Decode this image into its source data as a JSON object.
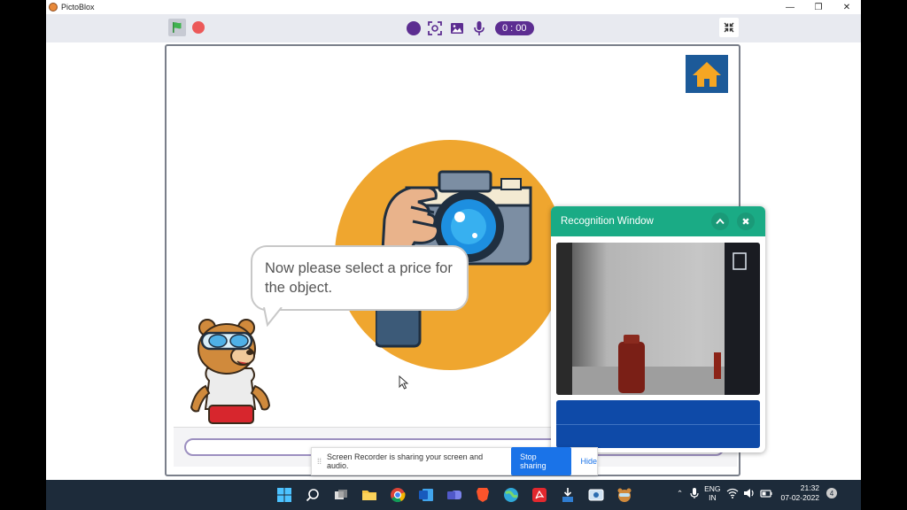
{
  "window": {
    "title": "PictoBlox",
    "minimize": "—",
    "maximize": "❐",
    "close": "✕"
  },
  "toolbar": {
    "timer": "0 : 00"
  },
  "stage": {
    "speech": "Now please select a price for the object."
  },
  "recognition": {
    "title": "Recognition Window",
    "collapse": "^",
    "close": "✖"
  },
  "screen_share": {
    "message": "Screen Recorder is sharing your screen and audio.",
    "stop_label": "Stop sharing",
    "hide_label": "Hide"
  },
  "taskbar": {
    "lang_line1": "ENG",
    "lang_line2": "IN",
    "time": "21:32",
    "date": "07-02-2022",
    "notifications": "4"
  },
  "colors": {
    "toolbar_bg": "#e8eaf0",
    "record_purple": "#5c2d91",
    "stop_red": "#ec5959",
    "home_blue": "#1c5a99",
    "sun_orange": "#efa62f",
    "recognition_green": "#1aab85",
    "recognition_bar_blue": "#0e4aa8",
    "taskbar_bg": "#1d2b3a",
    "share_button_blue": "#1a73e8"
  }
}
